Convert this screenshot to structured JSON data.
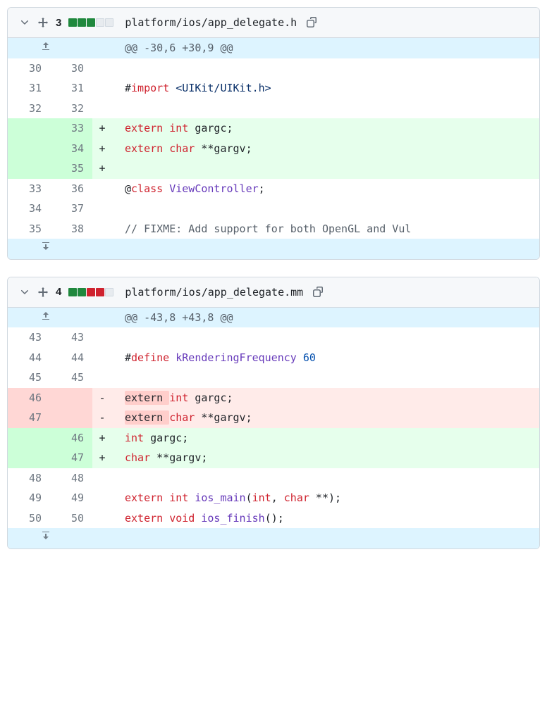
{
  "files": [
    {
      "changeCount": "3",
      "stats": [
        "added",
        "added",
        "added",
        "neutral",
        "neutral"
      ],
      "path": "platform/ios/app_delegate.h",
      "hunkHeader": "@@ -30,6 +30,9 @@",
      "rows": [
        {
          "type": "ctx",
          "old": "30",
          "new": "30",
          "code": ""
        },
        {
          "type": "ctx",
          "old": "31",
          "new": "31",
          "code": "#import <UIKit/UIKit.h>",
          "tokens": [
            [
              "#",
              "plain"
            ],
            [
              "import",
              "kw-red"
            ],
            [
              " ",
              "plain"
            ],
            [
              "<UIKit/UIKit.h>",
              "kw-str"
            ]
          ]
        },
        {
          "type": "ctx",
          "old": "32",
          "new": "32",
          "code": ""
        },
        {
          "type": "add",
          "old": "",
          "new": "33",
          "code": "extern int gargc;",
          "tokens": [
            [
              "extern",
              "kw-red"
            ],
            [
              " ",
              "plain"
            ],
            [
              "int",
              "kw-red"
            ],
            [
              " gargc;",
              "plain"
            ]
          ]
        },
        {
          "type": "add",
          "old": "",
          "new": "34",
          "code": "extern char **gargv;",
          "tokens": [
            [
              "extern",
              "kw-red"
            ],
            [
              " ",
              "plain"
            ],
            [
              "char",
              "kw-red"
            ],
            [
              " **gargv;",
              "plain"
            ]
          ]
        },
        {
          "type": "add",
          "old": "",
          "new": "35",
          "code": ""
        },
        {
          "type": "ctx",
          "old": "33",
          "new": "36",
          "code": "@class ViewController;",
          "tokens": [
            [
              "@",
              "plain"
            ],
            [
              "class",
              "kw-red"
            ],
            [
              " ",
              "plain"
            ],
            [
              "ViewController",
              "kw-purple"
            ],
            [
              ";",
              "plain"
            ]
          ]
        },
        {
          "type": "ctx",
          "old": "34",
          "new": "37",
          "code": ""
        },
        {
          "type": "ctx",
          "old": "35",
          "new": "38",
          "code": "// FIXME: Add support for both OpenGL and Vulkan",
          "tokens": [
            [
              "// FIXME: Add support for both OpenGL and Vul",
              "cm"
            ]
          ]
        }
      ]
    },
    {
      "changeCount": "4",
      "stats": [
        "added",
        "added",
        "removed",
        "removed",
        "neutral"
      ],
      "path": "platform/ios/app_delegate.mm",
      "hunkHeader": "@@ -43,8 +43,8 @@",
      "rows": [
        {
          "type": "ctx",
          "old": "43",
          "new": "43",
          "code": ""
        },
        {
          "type": "ctx",
          "old": "44",
          "new": "44",
          "code": "#define kRenderingFrequency 60",
          "tokens": [
            [
              "#",
              "plain"
            ],
            [
              "define",
              "kw-red"
            ],
            [
              " ",
              "plain"
            ],
            [
              "kRenderingFrequency",
              "kw-purple"
            ],
            [
              " ",
              "plain"
            ],
            [
              "60",
              "num-lit"
            ]
          ]
        },
        {
          "type": "ctx",
          "old": "45",
          "new": "45",
          "code": ""
        },
        {
          "type": "del",
          "old": "46",
          "new": "",
          "code": "extern int gargc;",
          "tokens": [
            [
              "extern ",
              "hl-del"
            ],
            [
              "int",
              "kw-red"
            ],
            [
              " gargc;",
              "plain"
            ]
          ]
        },
        {
          "type": "del",
          "old": "47",
          "new": "",
          "code": "extern char **gargv;",
          "tokens": [
            [
              "extern ",
              "hl-del"
            ],
            [
              "char",
              "kw-red"
            ],
            [
              " **gargv;",
              "plain"
            ]
          ]
        },
        {
          "type": "add",
          "old": "",
          "new": "46",
          "code": "int gargc;",
          "tokens": [
            [
              "int",
              "kw-red"
            ],
            [
              " gargc;",
              "plain"
            ]
          ]
        },
        {
          "type": "add",
          "old": "",
          "new": "47",
          "code": "char **gargv;",
          "tokens": [
            [
              "char",
              "kw-red"
            ],
            [
              " **gargv;",
              "plain"
            ]
          ]
        },
        {
          "type": "ctx",
          "old": "48",
          "new": "48",
          "code": ""
        },
        {
          "type": "ctx",
          "old": "49",
          "new": "49",
          "code": "extern int ios_main(int, char **);",
          "tokens": [
            [
              "extern",
              "kw-red"
            ],
            [
              " ",
              "plain"
            ],
            [
              "int",
              "kw-red"
            ],
            [
              " ",
              "plain"
            ],
            [
              "ios_main",
              "kw-purple"
            ],
            [
              "(",
              "plain"
            ],
            [
              "int",
              "kw-red"
            ],
            [
              ", ",
              "plain"
            ],
            [
              "char",
              "kw-red"
            ],
            [
              " **);",
              "plain"
            ]
          ]
        },
        {
          "type": "ctx",
          "old": "50",
          "new": "50",
          "code": "extern void ios_finish();",
          "tokens": [
            [
              "extern",
              "kw-red"
            ],
            [
              " ",
              "plain"
            ],
            [
              "void",
              "kw-red"
            ],
            [
              " ",
              "plain"
            ],
            [
              "ios_finish",
              "kw-purple"
            ],
            [
              "();",
              "plain"
            ]
          ]
        }
      ]
    }
  ]
}
